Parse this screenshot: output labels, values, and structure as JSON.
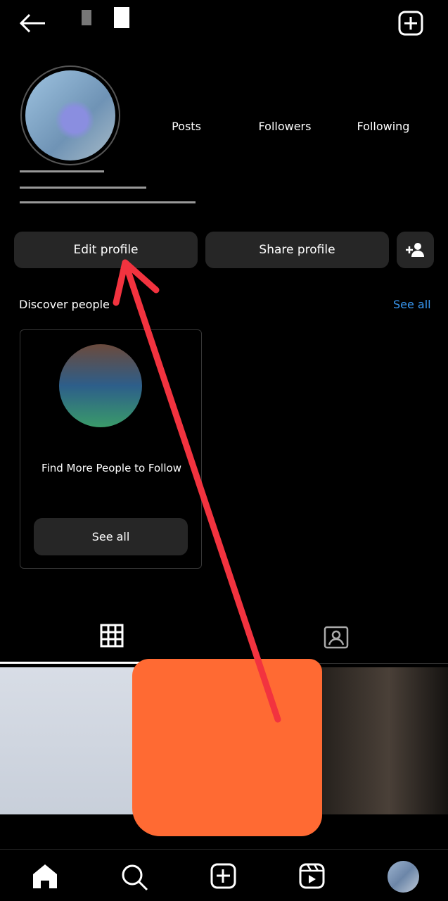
{
  "header": {
    "username": "",
    "icons": [
      "back-arrow-icon",
      "new-post-icon"
    ]
  },
  "profile": {
    "stats": [
      {
        "label": "Posts"
      },
      {
        "label": "Followers"
      },
      {
        "label": "Following"
      }
    ],
    "edit_profile": "Edit profile",
    "share_profile": "Share profile"
  },
  "discover": {
    "title": "Discover people",
    "see_all": "See all",
    "card_text": "Find More People to Follow",
    "card_button": "See all",
    "link_color": "#3897f0"
  },
  "tabs": [
    {
      "icon": "grid-icon",
      "active": true
    },
    {
      "icon": "tagged-icon",
      "active": false
    }
  ],
  "bottom_nav": [
    "home-icon",
    "search-icon",
    "create-icon",
    "reels-icon",
    "profile-avatar"
  ],
  "annotation_colors": {
    "arrow": "#f2333f",
    "redaction": "#ff6a33"
  }
}
